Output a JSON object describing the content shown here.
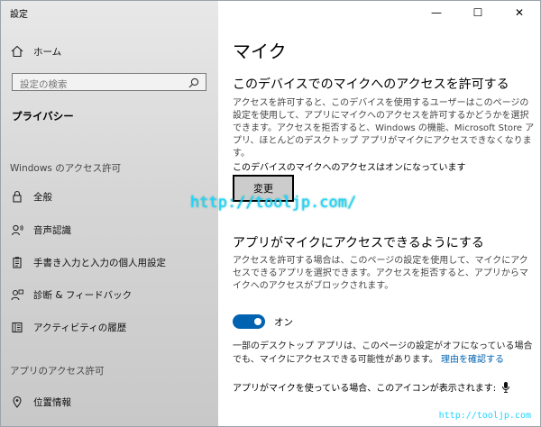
{
  "titlebar": {
    "title": "設定",
    "minimize": "—",
    "maximize": "☐",
    "close": "✕"
  },
  "sidebar": {
    "home": "ホーム",
    "search": {
      "placeholder": "設定の検索"
    },
    "category": "プライバシー",
    "section1": "Windows のアクセス許可",
    "items1": [
      {
        "label": "全般",
        "icon": "lock-icon"
      },
      {
        "label": "音声認識",
        "icon": "speech-icon"
      },
      {
        "label": "手書き入力と入力の個人用設定",
        "icon": "clipboard-icon"
      },
      {
        "label": "診断 & フィードバック",
        "icon": "feedback-icon"
      },
      {
        "label": "アクティビティの履歴",
        "icon": "history-icon"
      }
    ],
    "section2": "アプリのアクセス許可",
    "items2": [
      {
        "label": "位置情報",
        "icon": "location-icon"
      }
    ]
  },
  "main": {
    "title": "マイク",
    "section1": {
      "heading": "このデバイスでのマイクへのアクセスを許可する",
      "description": "アクセスを許可すると、このデバイスを使用するユーザーはこのページの設定を使用して、アプリにマイクへのアクセスを許可するかどうかを選択できます。アクセスを拒否すると、Windows の機能、Microsoft Store アプリ、ほとんどのデスクトップ アプリがマイクにアクセスできなくなります。",
      "status": "このデバイスのマイクへのアクセスはオンになっています",
      "button": "変更"
    },
    "section2": {
      "heading": "アプリがマイクにアクセスできるようにする",
      "description": "アクセスを許可する場合は、このページの設定を使用して、マイクにアクセスできるアプリを選択できます。アクセスを拒否すると、アプリからマイクへのアクセスがブロックされます。",
      "toggle_label": "オン",
      "toggle_on": true
    },
    "note": "一部のデスクトップ アプリは、このページの設定がオフになっている場合でも、マイクにアクセスできる可能性があります。",
    "note_link": "理由を確認する",
    "icon_line": "アプリがマイクを使っている場合、このアイコンが表示されます:"
  },
  "watermark": "http://tooljp.com/",
  "watermark_small": "http://tooljp.com",
  "colors": {
    "accent": "#0063b1",
    "watermark": "#22d4ff"
  }
}
